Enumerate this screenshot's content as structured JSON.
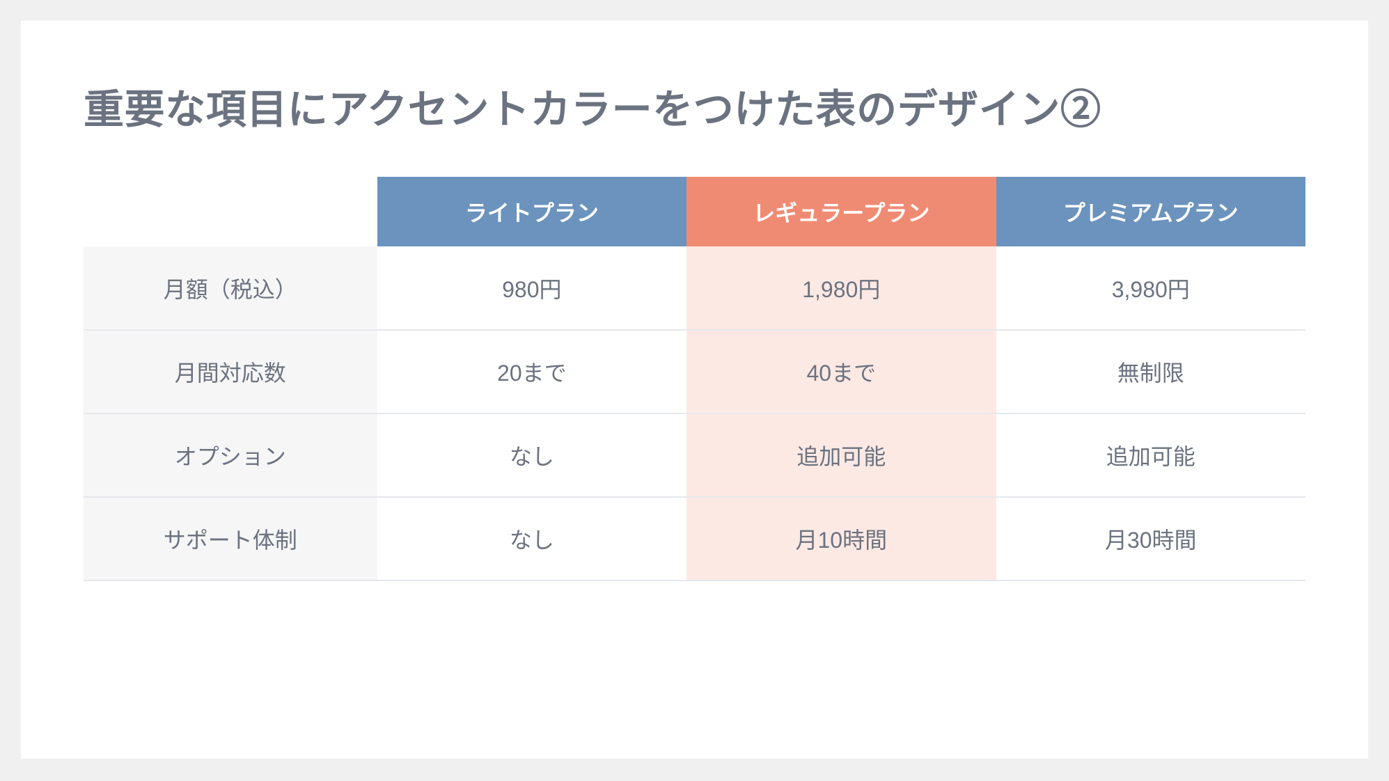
{
  "title": "重要な項目にアクセントカラーをつけた表のデザイン②",
  "colors": {
    "header_default": "#6b93bd",
    "header_accent": "#f08b73",
    "cell_accent": "#fde9e4",
    "rowhead_bg": "#f6f6f6",
    "text": "#6b7280"
  },
  "accent_column_index": 1,
  "plans": [
    {
      "name": "ライトプラン"
    },
    {
      "name": "レギュラープラン"
    },
    {
      "name": "プレミアムプラン"
    }
  ],
  "rows": [
    {
      "label": "月額（税込）",
      "values": [
        "980円",
        "1,980円",
        "3,980円"
      ]
    },
    {
      "label": "月間対応数",
      "values": [
        "20まで",
        "40まで",
        "無制限"
      ]
    },
    {
      "label": "オプション",
      "values": [
        "なし",
        "追加可能",
        "追加可能"
      ]
    },
    {
      "label": "サポート体制",
      "values": [
        "なし",
        "月10時間",
        "月30時間"
      ]
    }
  ]
}
